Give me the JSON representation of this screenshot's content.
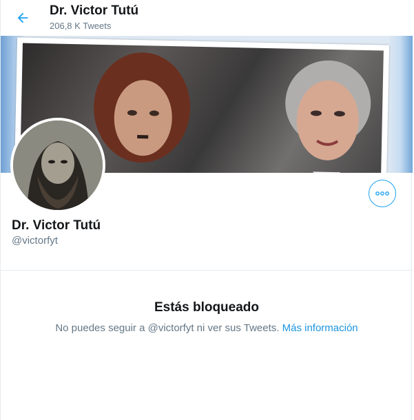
{
  "header": {
    "title": "Dr. Victor Tutú",
    "tweet_count": "206,8 K Tweets"
  },
  "profile": {
    "name": "Dr. Victor Tutú",
    "handle": "@victorfyt"
  },
  "blocked": {
    "title": "Estás bloqueado",
    "message": "No puedes seguir a @victorfyt ni ver sus Tweets.",
    "link": "Más información"
  },
  "colors": {
    "accent": "#1da1f2",
    "link": "#1b95e0",
    "secondary_text": "#657786",
    "primary_text": "#14171a"
  },
  "icons": {
    "back": "arrow-left-icon",
    "options": "more-options-icon"
  }
}
